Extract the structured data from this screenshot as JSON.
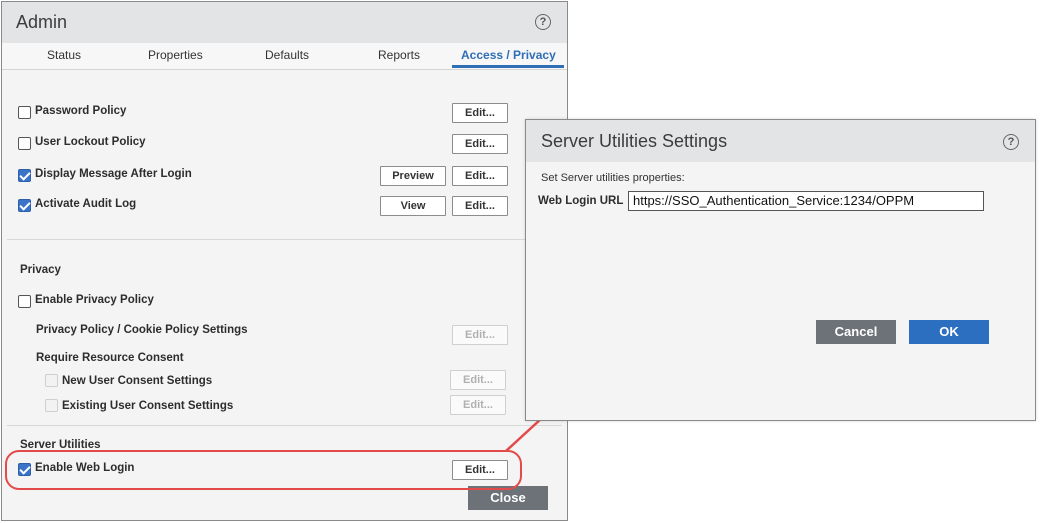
{
  "admin": {
    "title": "Admin",
    "tabs": [
      "Status",
      "Properties",
      "Defaults",
      "Reports",
      "Access / Privacy"
    ],
    "active_tab": "Access / Privacy",
    "access_rows": [
      {
        "label": "Password Policy",
        "checked": false,
        "edit": "Edit..."
      },
      {
        "label": "User Lockout Policy",
        "checked": false,
        "edit": "Edit..."
      },
      {
        "label": "Display Message After Login",
        "checked": true,
        "preview": "Preview",
        "edit": "Edit..."
      },
      {
        "label": "Activate Audit Log",
        "checked": true,
        "view": "View",
        "edit": "Edit..."
      }
    ],
    "privacy": {
      "heading": "Privacy",
      "enable_label": "Enable Privacy Policy",
      "enable_checked": false,
      "cookie_label": "Privacy Policy / Cookie Policy Settings",
      "cookie_edit": "Edit...",
      "consent_heading": "Require Resource Consent",
      "new_user_label": "New User Consent Settings",
      "new_user_edit": "Edit...",
      "existing_user_label": "Existing User Consent Settings",
      "existing_user_edit": "Edit..."
    },
    "server_utilities": {
      "heading": "Server Utilities",
      "enable_web_login": "Enable Web Login",
      "enable_web_login_checked": true,
      "edit": "Edit..."
    },
    "close": "Close"
  },
  "dialog": {
    "title": "Server Utilities Settings",
    "subtitle": "Set Server utilities properties:",
    "web_login_label": "Web Login URL",
    "web_login_value": "https://SSO_Authentication_Service:1234/OPPM",
    "cancel": "Cancel",
    "ok": "OK"
  },
  "colors": {
    "accent": "#2f6db5",
    "ok": "#2c6fc0",
    "secondary_button": "#6d7278",
    "highlight": "#e34a4a"
  },
  "icons": {
    "help": "question-circle-icon",
    "checkbox": "checkbox-icon",
    "arrow": "arrow-icon"
  }
}
